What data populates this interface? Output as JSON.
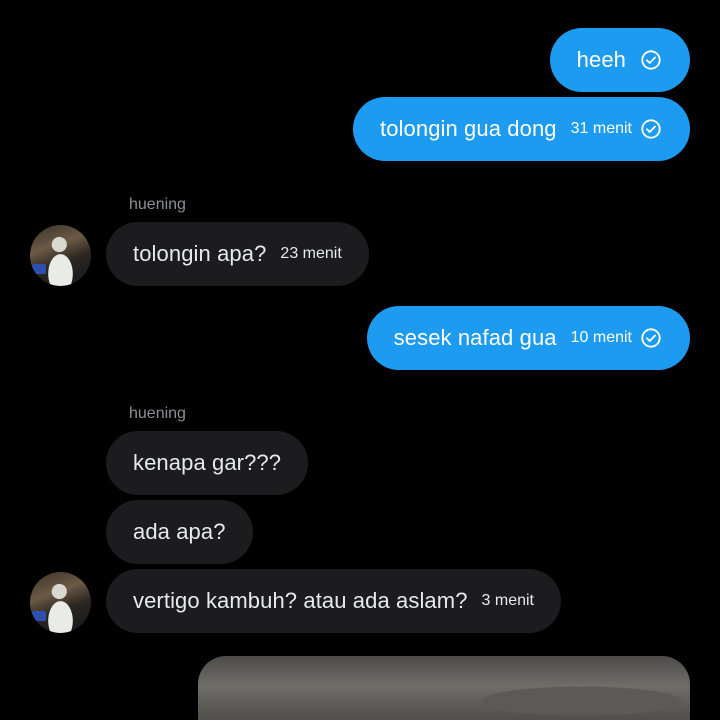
{
  "conversation": {
    "messages": [
      {
        "direction": "out",
        "text": "heeh",
        "time": "",
        "read": true
      },
      {
        "direction": "out",
        "text": "tolongin gua dong",
        "time": "31 menit",
        "read": true
      },
      {
        "direction": "in",
        "sender": "huening",
        "text": "tolongin apa?",
        "time": "23 menit"
      },
      {
        "direction": "out",
        "text": "sesek nafad gua",
        "time": "10 menit",
        "read": true
      },
      {
        "direction": "in",
        "sender": "huening",
        "text": "kenapa gar???",
        "time": ""
      },
      {
        "direction": "in",
        "text": "ada apa?",
        "time": ""
      },
      {
        "direction": "in",
        "text": "vertigo kambuh? atau ada aslam?",
        "time": "3 menit"
      }
    ]
  },
  "colors": {
    "background": "#000000",
    "outgoing_bubble": "#1d9bf0",
    "incoming_bubble": "#1c1c1f",
    "sender_label": "#8b8f94"
  },
  "icons": {
    "read_receipt": "check-circle-icon"
  }
}
